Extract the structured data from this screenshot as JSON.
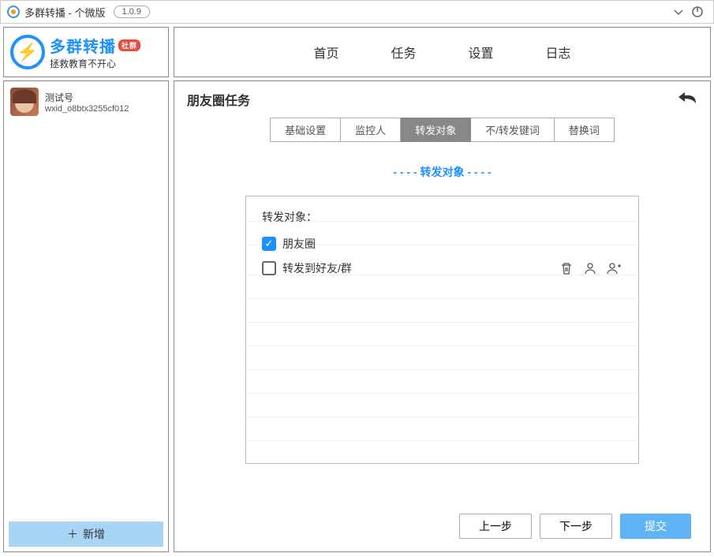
{
  "titlebar": {
    "title": "多群转播 - 个微版",
    "version": "1.0.9"
  },
  "logo": {
    "title": "多群转播",
    "badge": "社群",
    "subtitle": "拯救教育不开心"
  },
  "nav": {
    "items": [
      "首页",
      "任务",
      "设置",
      "日志"
    ]
  },
  "sidebar": {
    "account": {
      "name": "测试号",
      "id": "wxid_o8btx3255cf012"
    },
    "add_label": "新增"
  },
  "main": {
    "title": "朋友圈任务",
    "tabs": [
      "基础设置",
      "监控人",
      "转发对象",
      "不/转发键词",
      "替换词"
    ],
    "active_tab": 2,
    "divider": "- - - - 转发对象 - - - -",
    "form": {
      "label": "转发对象：",
      "options": [
        {
          "label": "朋友圈",
          "checked": true
        },
        {
          "label": "转发到好友/群",
          "checked": false
        }
      ]
    },
    "buttons": {
      "prev": "上一步",
      "next": "下一步",
      "submit": "提交"
    }
  }
}
